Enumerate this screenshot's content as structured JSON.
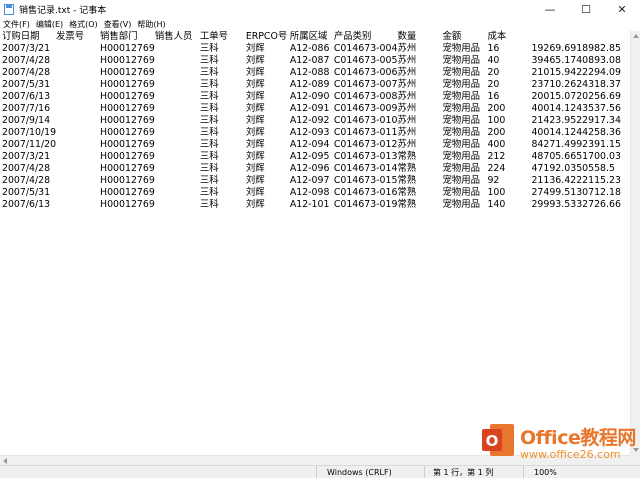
{
  "window": {
    "title": "销售记录.txt - 记事本",
    "controls": {
      "minimize": "—",
      "maximize": "☐",
      "close": "✕"
    }
  },
  "menu": [
    "文件(F)",
    "编辑(E)",
    "格式(O)",
    "查看(V)",
    "帮助(H)"
  ],
  "table": {
    "headers": [
      "订购日期",
      "发票号",
      "销售部门",
      "销售人员",
      "工单号",
      "ERPCO号",
      "所属区域",
      "产品类别",
      "数量",
      "金额",
      "成本"
    ],
    "rows": [
      [
        "2007/3/21",
        "",
        "H00012769",
        "",
        "三科",
        "刘辉",
        "A12-086",
        "C014673-004",
        "苏州",
        "宠物用品",
        "16",
        "19269.69",
        "18982.85"
      ],
      [
        "2007/4/28",
        "",
        "H00012769",
        "",
        "三科",
        "刘辉",
        "A12-087",
        "C014673-005",
        "苏州",
        "宠物用品",
        "40",
        "39465.17",
        "40893.08"
      ],
      [
        "2007/4/28",
        "",
        "H00012769",
        "",
        "三科",
        "刘辉",
        "A12-088",
        "C014673-006",
        "苏州",
        "宠物用品",
        "20",
        "21015.94",
        "22294.09"
      ],
      [
        "2007/5/31",
        "",
        "H00012769",
        "",
        "三科",
        "刘辉",
        "A12-089",
        "C014673-007",
        "苏州",
        "宠物用品",
        "20",
        "23710.26",
        "24318.37"
      ],
      [
        "2007/6/13",
        "",
        "H00012769",
        "",
        "三科",
        "刘辉",
        "A12-090",
        "C014673-008",
        "苏州",
        "宠物用品",
        "16",
        "20015.07",
        "20256.69"
      ],
      [
        "2007/7/16",
        "",
        "H00012769",
        "",
        "三科",
        "刘辉",
        "A12-091",
        "C014673-009",
        "苏州",
        "宠物用品",
        "200",
        "40014.12",
        "43537.56"
      ],
      [
        "2007/9/14",
        "",
        "H00012769",
        "",
        "三科",
        "刘辉",
        "A12-092",
        "C014673-010",
        "苏州",
        "宠物用品",
        "100",
        "21423.95",
        "22917.34"
      ],
      [
        "2007/10/19",
        "",
        "H00012769",
        "",
        "三科",
        "刘辉",
        "A12-093",
        "C014673-011",
        "苏州",
        "宠物用品",
        "200",
        "40014.12",
        "44258.36"
      ],
      [
        "2007/11/20",
        "",
        "H00012769",
        "",
        "三科",
        "刘辉",
        "A12-094",
        "C014673-012",
        "苏州",
        "宠物用品",
        "400",
        "84271.49",
        "92391.15"
      ],
      [
        "2007/3/21",
        "",
        "H00012769",
        "",
        "三科",
        "刘辉",
        "A12-095",
        "C014673-013",
        "常熟",
        "宠物用品",
        "212",
        "48705.66",
        "51700.03"
      ],
      [
        "2007/4/28",
        "",
        "H00012769",
        "",
        "三科",
        "刘辉",
        "A12-096",
        "C014673-014",
        "常熟",
        "宠物用品",
        "224",
        "47192.03",
        "50558.5"
      ],
      [
        "2007/4/28",
        "",
        "H00012769",
        "",
        "三科",
        "刘辉",
        "A12-097",
        "C014673-015",
        "常熟",
        "宠物用品",
        "92",
        "21136.42",
        "22115.23"
      ],
      [
        "2007/5/31",
        "",
        "H00012769",
        "",
        "三科",
        "刘辉",
        "A12-098",
        "C014673-016",
        "常熟",
        "宠物用品",
        "100",
        "27499.51",
        "30712.18"
      ],
      [
        "2007/6/13",
        "",
        "H00012769",
        "",
        "三科",
        "刘辉",
        "A12-101",
        "C014673-019",
        "常熟",
        "宠物用品",
        "140",
        "29993.53",
        "32726.66"
      ]
    ]
  },
  "status": {
    "encoding": "Windows (CRLF)",
    "position": "第 1 行，第 1 列",
    "zoom": "100%"
  },
  "watermark": {
    "brand": "Office教程网",
    "url": "www.office26.com",
    "colors": {
      "orange": "#e8762c",
      "red": "#d9441c"
    }
  }
}
